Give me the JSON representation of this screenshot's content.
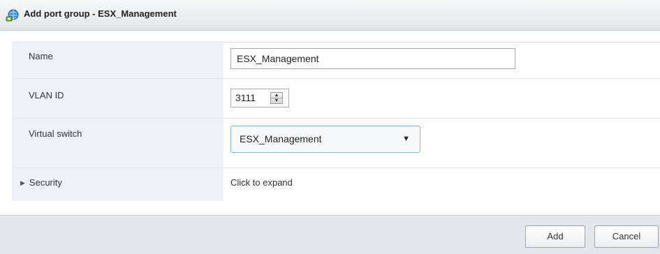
{
  "dialog": {
    "title": "Add port group - ESX_Management",
    "icon": "network-portgroup-icon"
  },
  "form": {
    "name_label": "Name",
    "name_value": "ESX_Management",
    "vlan_label": "VLAN ID",
    "vlan_value": "3111",
    "vswitch_label": "Virtual switch",
    "vswitch_value": "ESX_Management",
    "security_label": "Security",
    "security_value": "Click to expand"
  },
  "footer": {
    "add_label": "Add",
    "cancel_label": "Cancel"
  },
  "colors": {
    "label_bg": "#edf2f8",
    "select_border": "#7fb5e6",
    "footer_bg": "#e3e6ea"
  }
}
